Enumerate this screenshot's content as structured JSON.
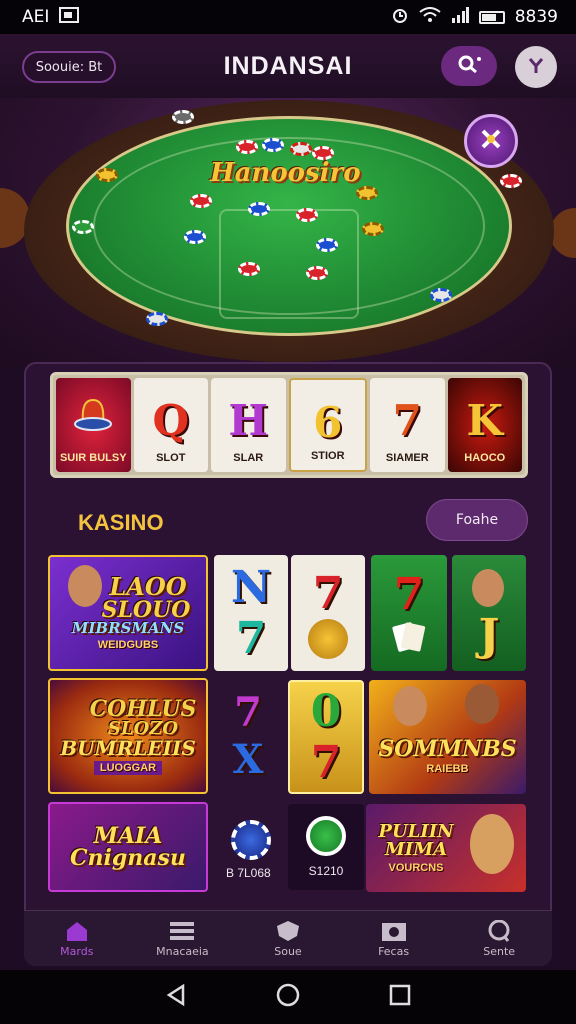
{
  "status_bar": {
    "carrier": "AEI",
    "time": "8839"
  },
  "header": {
    "left_button": "Soouie: Bt",
    "title": "INDANSAI"
  },
  "hero": {
    "title": "Hanoosiro"
  },
  "reels": [
    {
      "symbol": "",
      "label": "SUIR BULSY"
    },
    {
      "symbol": "Q",
      "label": "SLOT"
    },
    {
      "symbol": "H",
      "label": "SLAR"
    },
    {
      "symbol": "6",
      "label": "STIOR"
    },
    {
      "symbol": "7",
      "label": "SIAMER"
    },
    {
      "symbol": "K",
      "label": "HAOCO"
    }
  ],
  "section": {
    "title": "KASINO",
    "filter_label": "Foahe"
  },
  "games": {
    "g1": {
      "line1": "LAOO",
      "line2": "SLOUO",
      "line3": "MIBRSMANS",
      "sub": "WEIDGUBS"
    },
    "g2": {
      "top": "N",
      "bottom": "7"
    },
    "g3": {
      "top": "7",
      "bottom": ""
    },
    "g4": {
      "top": "7",
      "bottom": ""
    },
    "g5": {
      "bottom": "J"
    },
    "g6": {
      "line1": "COHLUS",
      "line2": "SLOZO",
      "line3": "BUMRLEIIS",
      "sub": "LUOGGAR"
    },
    "g7": {
      "top": "7",
      "bottom": "X"
    },
    "g8": {
      "top": "0",
      "bottom": "7"
    },
    "g9": {
      "line1": "SOMMNBS",
      "sub": "RAIEBB"
    },
    "g10": {
      "line1": "MAIA",
      "line2": "Cnignasu"
    },
    "g11": {
      "label": "B 7L068"
    },
    "g12": {
      "label": "S1210"
    },
    "g13": {
      "line1": "PULIIN",
      "line2": "MIMA",
      "sub": "VOURCNS"
    }
  },
  "nav": [
    {
      "label": "Mards",
      "icon": "home-icon"
    },
    {
      "label": "Mnacaeia",
      "icon": "menu-icon"
    },
    {
      "label": "Soue",
      "icon": "shield-icon"
    },
    {
      "label": "Fecas",
      "icon": "camera-icon"
    },
    {
      "label": "Sente",
      "icon": "chat-icon"
    }
  ]
}
